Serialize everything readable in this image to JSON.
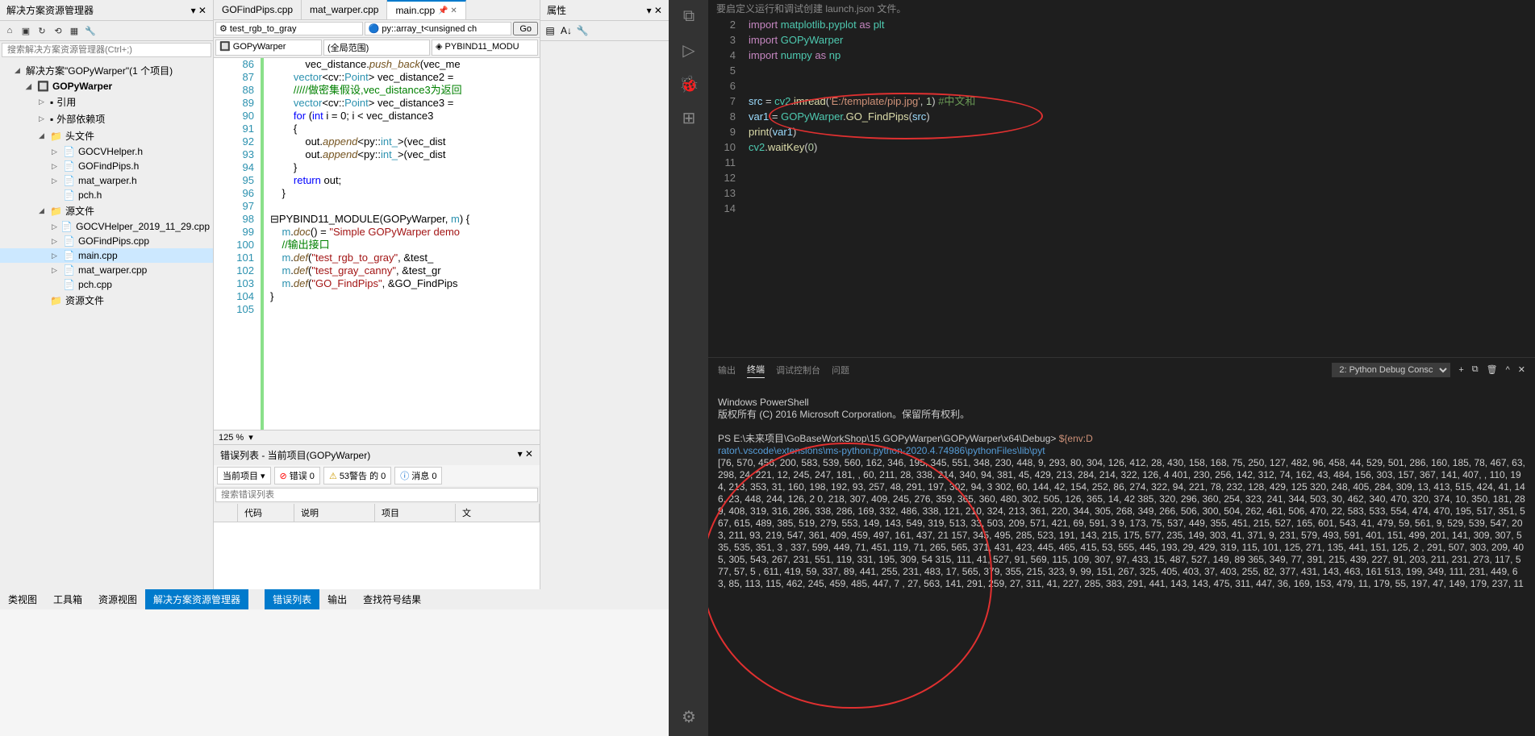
{
  "sln": {
    "title": "解决方案资源管理器",
    "search_placeholder": "搜索解决方案资源管理器(Ctrl+;)",
    "root": "解决方案\"GOPyWarper\"(1 个项目)",
    "project": "GOPyWarper",
    "refs": "引用",
    "extdeps": "外部依赖项",
    "headers": "头文件",
    "header_files": [
      "GOCVHelper.h",
      "GOFindPips.h",
      "mat_warper.h",
      "pch.h"
    ],
    "sources": "源文件",
    "source_files": [
      "GOCVHelper_2019_11_29.cpp",
      "GOFindPips.cpp",
      "main.cpp",
      "mat_warper.cpp",
      "pch.cpp"
    ],
    "resources": "资源文件"
  },
  "editor": {
    "tabs": [
      "GOFindPips.cpp",
      "mat_warper.cpp",
      "main.cpp"
    ],
    "combo1": "test_rgb_to_gray",
    "combo2": "py::array_t<unsigned ch",
    "go": "Go",
    "nav1": "GOPyWarper",
    "nav2": "(全局范围)",
    "nav3": "PYBIND11_MODU",
    "zoom": "125 %",
    "lines": [
      {
        "n": 86,
        "html": "            vec_distance.<span class='func'>push_back</span>(vec_me"
      },
      {
        "n": 87,
        "html": "        <span class='type'>vector</span>&lt;cv::<span class='type'>Point</span>&gt; vec_distance2 ="
      },
      {
        "n": 88,
        "html": "        <span class='comment'>/////做密集假设,vec_distance3为返回</span>"
      },
      {
        "n": 89,
        "html": "        <span class='type'>vector</span>&lt;cv::<span class='type'>Point</span>&gt; vec_distance3 ="
      },
      {
        "n": 90,
        "html": "        <span class='kw'>for</span> (<span class='kw'>int</span> i = 0; i &lt; vec_distance3"
      },
      {
        "n": 91,
        "html": "        {"
      },
      {
        "n": 92,
        "html": "            out.<span class='func'>append</span>&lt;py::<span class='type'>int_</span>&gt;(vec_dist"
      },
      {
        "n": 93,
        "html": "            out.<span class='func'>append</span>&lt;py::<span class='type'>int_</span>&gt;(vec_dist"
      },
      {
        "n": 94,
        "html": "        }"
      },
      {
        "n": 95,
        "html": "        <span class='kw'>return</span> out;"
      },
      {
        "n": 96,
        "html": "    }"
      },
      {
        "n": 97,
        "html": ""
      },
      {
        "n": 98,
        "html": "⊟PYBIND11_MODULE(GOPyWarper, <span class='type'>m</span>) {"
      },
      {
        "n": 99,
        "html": "    <span class='type'>m</span>.<span class='func'>doc</span>() = <span class='str'>\"Simple GOPyWarper demo</span>"
      },
      {
        "n": 100,
        "html": "    <span class='comment'>//输出接口</span>"
      },
      {
        "n": 101,
        "html": "    <span class='type'>m</span>.<span class='func'>def</span>(<span class='str'>\"test_rgb_to_gray\"</span>, &amp;test_"
      },
      {
        "n": 102,
        "html": "    <span class='type'>m</span>.<span class='func'>def</span>(<span class='str'>\"test_gray_canny\"</span>, &amp;test_gr"
      },
      {
        "n": 103,
        "html": "    <span class='type'>m</span>.<span class='func'>def</span>(<span class='str'>\"GO_FindPips\"</span>, &amp;GO_FindPips"
      },
      {
        "n": 104,
        "html": "}"
      },
      {
        "n": 105,
        "html": ""
      }
    ]
  },
  "err": {
    "title": "错误列表 - 当前项目(GOPyWarper)",
    "combo": "当前项目",
    "errors": "错误 0",
    "warnings": "53警告 的 0",
    "messages": "消息 0",
    "search": "搜索错误列表",
    "cols": [
      "",
      "代码",
      "说明",
      "项目",
      "文"
    ]
  },
  "btabs": {
    "left": [
      "类视图",
      "工具箱",
      "资源视图",
      "解决方案资源管理器"
    ],
    "mid": [
      "错误列表",
      "输出",
      "查找符号结果"
    ]
  },
  "props": {
    "title": "属性"
  },
  "vscode": {
    "top_hint": "要启定义运行和调试创建 launch.json 文件。",
    "lines": [
      {
        "n": 2,
        "html": "<span class='py-kw'>import</span> <span class='py-mod'>matplotlib</span>.<span class='py-mod'>pyplot</span> <span class='py-kw'>as</span> <span class='py-mod'>plt</span>"
      },
      {
        "n": 3,
        "html": "<span class='py-kw'>import</span> <span class='py-mod'>GOPyWarper</span>"
      },
      {
        "n": 4,
        "html": "<span class='py-kw'>import</span> <span class='py-mod'>numpy</span> <span class='py-kw'>as</span> <span class='py-mod'>np</span>"
      },
      {
        "n": 5,
        "html": ""
      },
      {
        "n": 6,
        "html": ""
      },
      {
        "n": 7,
        "html": "<span class='py-var'>src</span> = <span class='py-mod'>cv2</span>.<span class='py-fn'>imread</span>(<span class='py-str'>'E:/template/pip.jpg'</span>, <span class='py-num'>1</span>) <span class='py-comment'>#中文和</span>"
      },
      {
        "n": 8,
        "html": "<span class='py-var'>var1</span> = <span class='py-mod'>GOPyWarper</span>.<span class='py-fn'>GO_FindPips</span>(<span class='py-var'>src</span>)"
      },
      {
        "n": 9,
        "html": "<span class='py-fn'>print</span>(<span class='py-var'>var1</span>)"
      },
      {
        "n": 10,
        "html": "<span class='py-mod'>cv2</span>.<span class='py-fn'>waitKey</span>(<span class='py-num'>0</span>)"
      },
      {
        "n": 11,
        "html": ""
      },
      {
        "n": 12,
        "html": ""
      },
      {
        "n": 13,
        "html": ""
      },
      {
        "n": 14,
        "html": ""
      }
    ],
    "term": {
      "tabs": [
        "输出",
        "终端",
        "调试控制台",
        "问题"
      ],
      "selector": "2: Python Debug Consc",
      "ps_header": "Windows PowerShell",
      "ps_copy": "版权所有 (C) 2016 Microsoft Corporation。保留所有权利。",
      "prompt": "PS E:\\未来项目\\GoBaseWorkShop\\15.GOPyWarper\\GOPyWarper\\x64\\Debug>",
      "cmd": "${env:D",
      "cmd2": "rator\\.vscode\\extensions\\ms-python.python-2020.4.74986\\pythonFiles\\lib\\pyt",
      "output": "[76, 570, 456, 200, 583, 539, 560, 162, 346, 195, 345, 551, 348, 230, 448, 9, 293, 80, 304, 126, 412, 28, 430, 158, 168, 75, 250, 127, 482, 96, 458, 44, 529, 501, 286, 160, 185, 78, 467, 63, 298, 24, 221, 12, 245, 247, 181, , 60, 211, 28, 338, 214, 340, 94, 381, 45, 429, 213, 284, 214, 322, 126, 4 401, 230, 256, 142, 312, 74, 162, 43, 484, 156, 303, 157, 367, 141, 407, , 110, 194, 213, 353, 31, 160, 198, 192, 93, 257, 48, 291, 197, 302, 94, 3 302, 60, 144, 42, 154, 252, 86, 274, 322, 94, 221, 78, 232, 128, 429, 125 320, 248, 405, 284, 309, 13, 413, 515, 424, 41, 146, 23, 448, 244, 126, 2 0, 218, 307, 409, 245, 276, 359, 365, 360, 480, 302, 505, 126, 365, 14, 42 385, 320, 296, 360, 254, 323, 241, 344, 503, 30, 462, 340, 470, 320, 374, 10, 350, 181, 289, 408, 319, 316, 286, 338, 286, 169, 332, 486, 338, 121, 210, 324, 213, 361, 220, 344, 305, 268, 349, 266, 506, 300, 504, 262, 461, 506, 470, 22, 583, 533, 554, 474, 470, 195, 517, 351, 567, 615, 489, 385, 519, 279, 553, 149, 143, 549, 319, 513, 33, 503, 209, 571, 421, 69, 591, 3 9, 173, 75, 537, 449, 355, 451, 215, 527, 165, 601, 543, 41, 479, 59, 561, 9, 529, 539, 547, 203, 211, 93, 219, 547, 361, 409, 459, 497, 161, 437, 21 157, 345, 495, 285, 523, 191, 143, 215, 175, 577, 235, 149, 303, 41, 371, 9, 231, 579, 493, 591, 401, 151, 499, 201, 141, 309, 307, 535, 535, 351, 3 , 337, 599, 449, 71, 451, 119, 71, 265, 565, 371, 431, 423, 445, 465, 415, 53, 555, 445, 193, 29, 429, 319, 115, 101, 125, 271, 135, 441, 151, 125, 2 , 291, 507, 303, 209, 405, 305, 543, 267, 231, 551, 119, 331, 195, 309, 54 315, 111, 41, 527, 91, 569, 115, 109, 307, 97, 433, 15, 487, 527, 149, 89 365, 349, 77, 391, 215, 439, 227, 91, 203, 211, 231, 273, 117, 577, 57, 5 , 611, 419, 59, 337, 89, 441, 255, 231, 483, 17, 565, 379, 355, 215, 323, 9, 99, 151, 267, 325, 405, 403, 37, 403, 255, 82, 377, 431, 143, 463, 161 513, 199, 349, 111, 231, 449, 63, 85, 113, 115, 462, 245, 459, 485, 447, 7 , 27, 563, 141, 291, 259, 27, 311, 41, 227, 285, 383, 291, 441, 143, 143, 475, 311, 447, 36, 169, 153, 479, 11, 179, 55, 197, 47, 149, 179, 237, 11"
    }
  }
}
